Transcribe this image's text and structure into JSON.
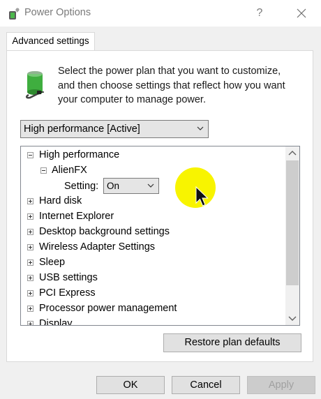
{
  "window": {
    "title": "Power Options",
    "help_glyph": "?"
  },
  "tabs": [
    {
      "label": "Advanced settings",
      "active": true
    }
  ],
  "description": "Select the power plan that you want to customize, and then choose settings that reflect how you want your computer to manage power.",
  "plan_select": {
    "value": "High performance [Active]"
  },
  "tree": {
    "items": [
      {
        "label": "High performance",
        "expanded": true,
        "depth": 0
      },
      {
        "label": "AlienFX",
        "expanded": true,
        "depth": 1
      },
      {
        "label": "Hard disk",
        "expanded": false,
        "depth": 0
      },
      {
        "label": "Internet Explorer",
        "expanded": false,
        "depth": 0
      },
      {
        "label": "Desktop background settings",
        "expanded": false,
        "depth": 0
      },
      {
        "label": "Wireless Adapter Settings",
        "expanded": false,
        "depth": 0
      },
      {
        "label": "Sleep",
        "expanded": false,
        "depth": 0
      },
      {
        "label": "USB settings",
        "expanded": false,
        "depth": 0
      },
      {
        "label": "PCI Express",
        "expanded": false,
        "depth": 0
      },
      {
        "label": "Processor power management",
        "expanded": false,
        "depth": 0
      },
      {
        "label": "Display",
        "expanded": false,
        "depth": 0
      }
    ],
    "setting": {
      "label": "Setting:",
      "value": "On"
    }
  },
  "buttons": {
    "restore": "Restore plan defaults",
    "ok": "OK",
    "cancel": "Cancel",
    "apply": "Apply"
  },
  "colors": {
    "highlight": "#f8f400",
    "battery_green": "#3fae3f"
  },
  "icons": [
    "power-options-icon",
    "battery-plug-icon",
    "close-icon",
    "chevron-down-icon",
    "scroll-up-icon",
    "scroll-down-icon",
    "mouse-pointer-icon"
  ]
}
